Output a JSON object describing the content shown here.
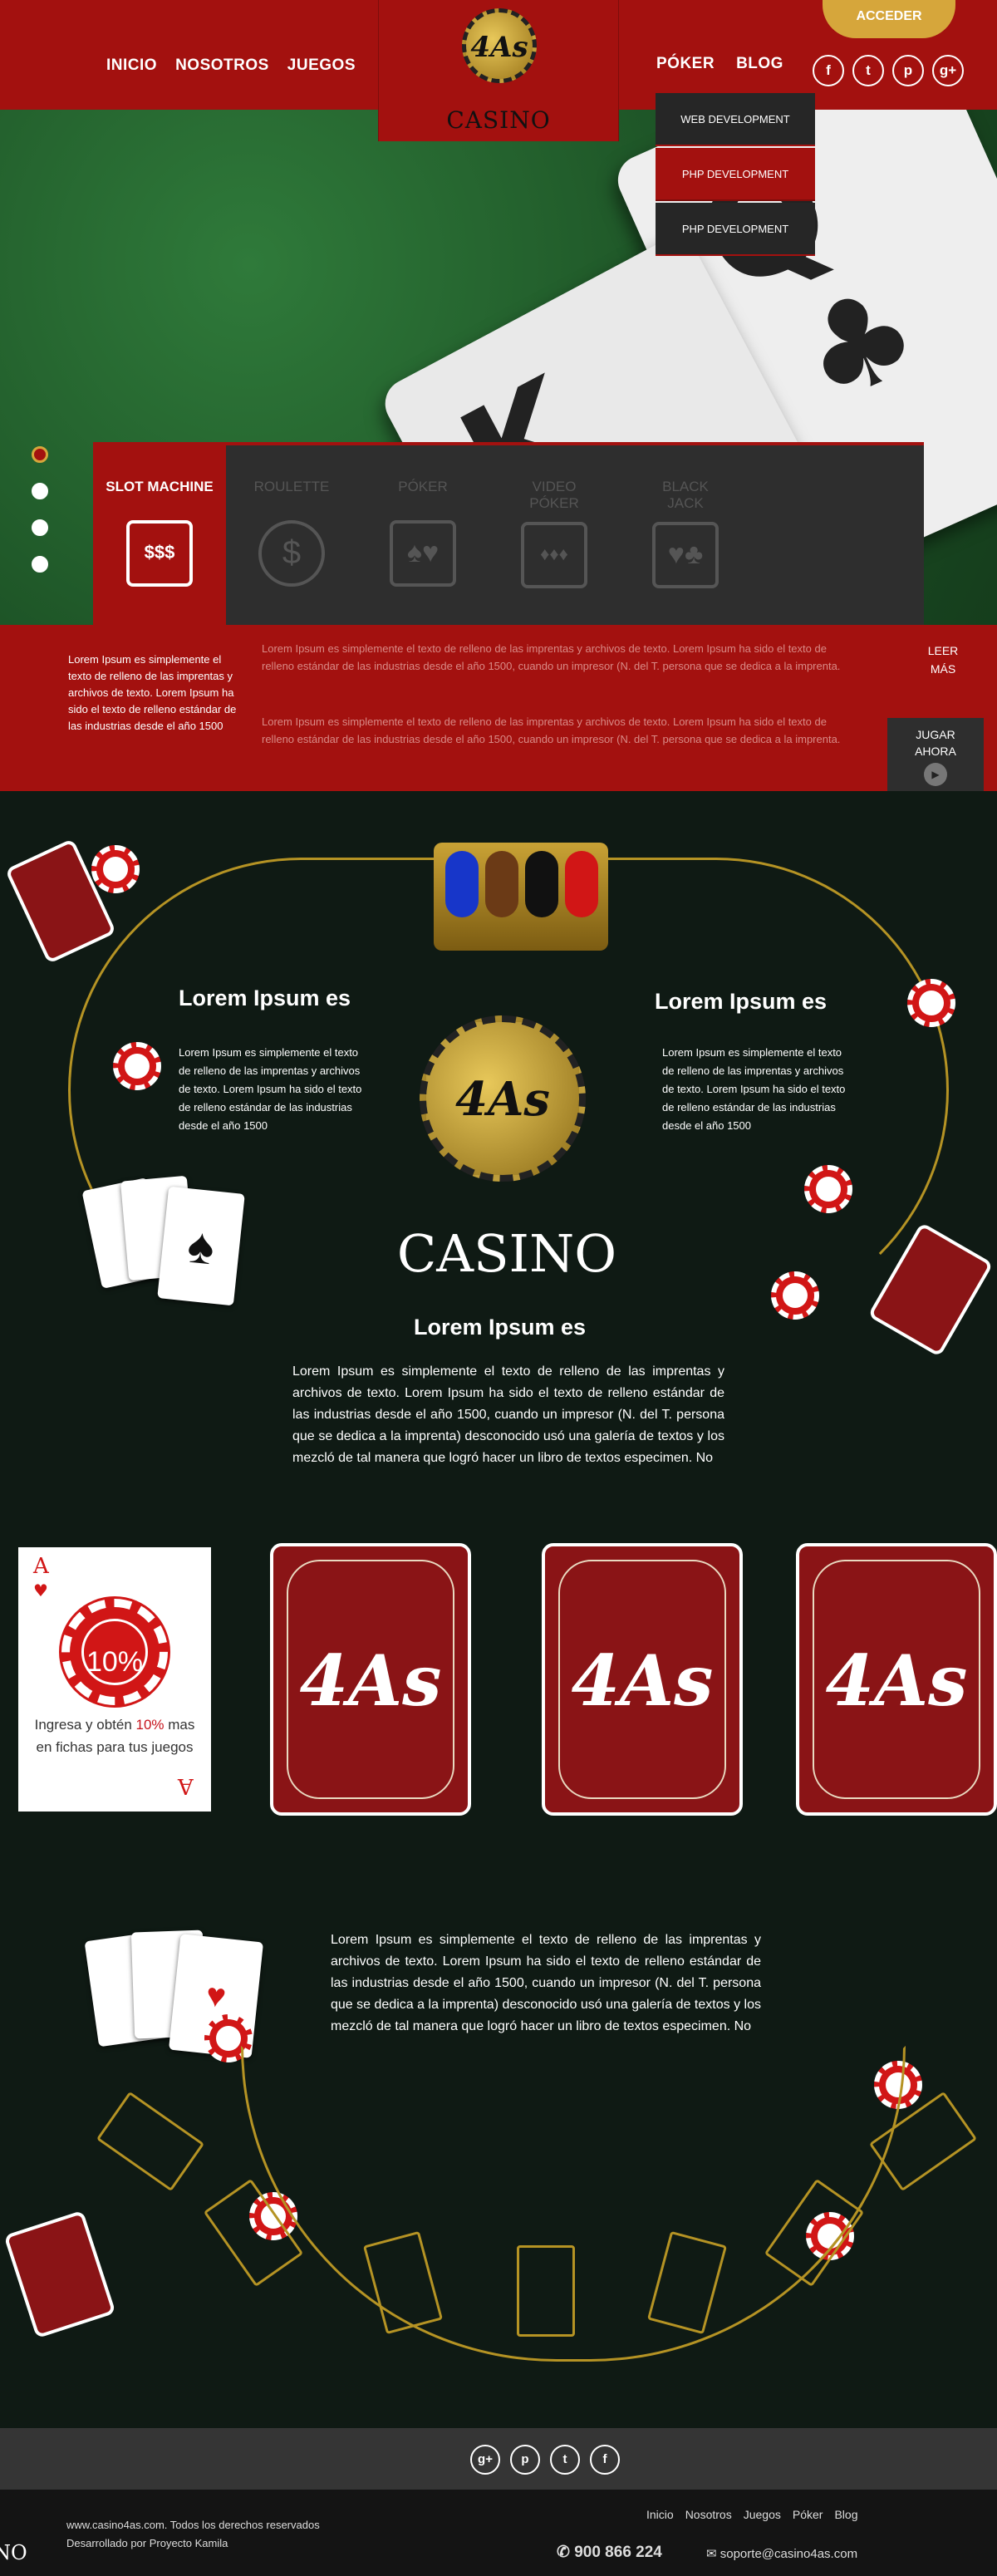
{
  "header": {
    "nav_left": [
      "INICIO",
      "NOSOTROS",
      "JUEGOS"
    ],
    "nav_right": [
      "PÓKER",
      "BLOG"
    ],
    "logo_text": "4As",
    "logo_word": "CASINO",
    "acceder": "ACCEDER",
    "socials": [
      "f",
      "t",
      "p",
      "g+"
    ]
  },
  "dropdown": [
    "WEB DEVELOPMENT",
    "PHP DEVELOPMENT",
    "PHP DEVELOPMENT"
  ],
  "games": [
    "SLOT MACHINE",
    "ROULETTE",
    "PÓKER",
    "VIDEO PÓKER",
    "BLACK JACK"
  ],
  "info": {
    "left": "Lorem Ipsum es simplemente el texto de relleno de las imprentas y archivos de texto. Lorem Ipsum ha sido el texto de relleno estándar de las industrias desde el año 1500",
    "mid1": "Lorem Ipsum es simplemente el texto de relleno de las imprentas y archivos de texto. Lorem Ipsum ha sido el texto de relleno estándar de las industrias desde el año 1500, cuando un impresor (N. del T. persona que se dedica a la imprenta.",
    "mid2": "Lorem Ipsum es simplemente el texto de relleno de las imprentas y archivos de texto. Lorem Ipsum ha sido el texto de relleno estándar de las industrias desde el año 1500, cuando un impresor (N. del T. persona que se dedica a la imprenta.",
    "leer": "LEER MÁS",
    "jugar": "JUGAR AHORA"
  },
  "table": {
    "h_left": "Lorem Ipsum es",
    "p_left": "Lorem Ipsum es simplemente el texto de relleno de las imprentas y archivos de texto. Lorem Ipsum ha sido el texto de relleno estándar de las industrias desde el año 1500",
    "h_right": "Lorem Ipsum es",
    "p_right": "Lorem Ipsum es simplemente el texto de relleno de las imprentas y archivos de texto. Lorem Ipsum ha sido el texto de relleno estándar de las industrias desde el año 1500",
    "center_logo": "4As",
    "center_word": "CASINO",
    "h_center": "Lorem Ipsum es",
    "p_center": "Lorem Ipsum es simplemente el texto de relleno de las imprentas y archivos de texto. Lorem Ipsum ha sido el texto de relleno estándar de las industrias desde el año 1500, cuando un impresor (N. del T. persona que se dedica a la imprenta) desconocido usó una galería de textos y los mezcló de tal manera que logró hacer un libro de textos especimen. No"
  },
  "promo": {
    "card_rank": "A",
    "percent": "10%",
    "text_before": "Ingresa y obtén ",
    "text_highlight": "10%",
    "text_after": " mas en fichas para tus juegos"
  },
  "big_card_text": "4As",
  "blackjack": {
    "paragraph": "Lorem Ipsum es simplemente el texto de relleno de las imprentas y archivos de texto. Lorem Ipsum ha sido el texto de relleno estándar de las industrias desde el año 1500, cuando un impresor (N. del T. persona que se dedica a la imprenta) desconocido usó una galería de textos y los mezcló de tal manera que logró hacer un libro de textos especimen. No"
  },
  "footer": {
    "socials": [
      "g+",
      "p",
      "t",
      "f"
    ],
    "copyright": "www.casino4as.com. Todos los derechos reservados",
    "credit": "Desarrollado por Proyecto Kamila",
    "links": [
      "Inicio",
      "Nosotros",
      "Juegos",
      "Póker",
      "Blog"
    ],
    "phone": "900 866 224",
    "email": "soporte@casino4as.com",
    "logo_fragment": "NO"
  },
  "colors": {
    "brand_red": "#a3110f",
    "gold": "#d6a63b",
    "felt": "#0f1a14"
  }
}
